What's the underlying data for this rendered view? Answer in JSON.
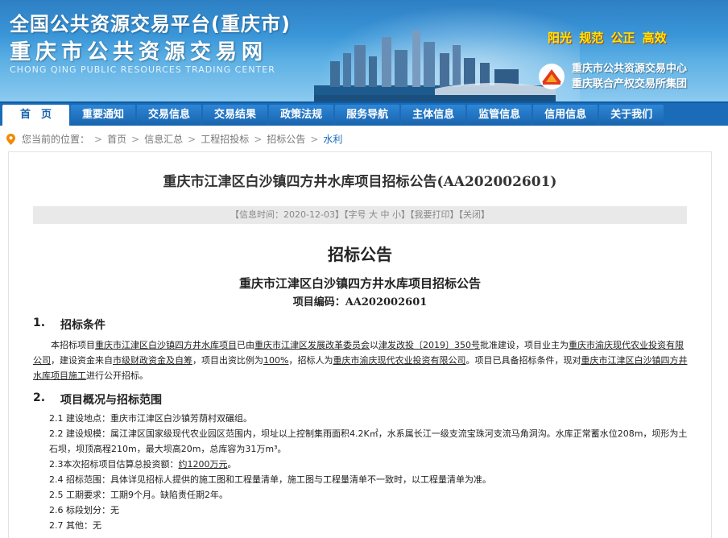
{
  "header": {
    "title_cn": "全国公共资源交易平台(重庆市)",
    "subtitle_cn": "重庆市公共资源交易网",
    "title_en": "CHONG QING PUBLIC RESOURCES TRADING CENTER",
    "slogan": "阳光 规范 公正 高效",
    "org_line1": "重庆市公共资源交易中心",
    "org_line2": "重庆联合产权交易所集团"
  },
  "nav": {
    "items": [
      {
        "label": "首　页"
      },
      {
        "label": "重要通知"
      },
      {
        "label": "交易信息"
      },
      {
        "label": "交易结果"
      },
      {
        "label": "政策法规"
      },
      {
        "label": "服务导航"
      },
      {
        "label": "主体信息"
      },
      {
        "label": "监管信息"
      },
      {
        "label": "信用信息"
      },
      {
        "label": "关于我们"
      }
    ]
  },
  "breadcrumb": {
    "prefix": "您当前的位置：",
    "items": [
      "首页",
      "信息汇总",
      "工程招投标",
      "招标公告",
      "水利"
    ],
    "separator": ">"
  },
  "article": {
    "title": "重庆市江津区白沙镇四方井水库项目招标公告(AA202002601)",
    "meta": {
      "time": "【信息时间：2020-12-03】",
      "font_label": "【字号",
      "font_large": "大",
      "font_medium": "中",
      "font_small": "小】",
      "print": "【我要打印】",
      "close": "【关闭】"
    }
  },
  "document": {
    "heading": "招标公告",
    "subheading": "重庆市江津区白沙镇四方井水库项目招标公告",
    "code": "项目编码：AA202002601",
    "sections": [
      {
        "num": "1.",
        "title": "招标条件"
      },
      {
        "num": "2.",
        "title": "项目概况与招标范围"
      }
    ],
    "para1": {
      "t1": "本招标项目",
      "u1": "重庆市江津区白沙镇四方井水库项目",
      "t2": "已由",
      "u2": "重庆市江津区发展改革委员会",
      "t3": "以",
      "u3": "津发改投〔2019〕350号",
      "t4": "批准建设，项目业主为",
      "u4": "重庆市渝庆现代农业投资有限公司",
      "t5": "，建设资金来自",
      "u5": "市级财政资金及自筹",
      "t6": "，项目出资比例为",
      "u6": "100%",
      "t7": "，招标人为",
      "u7": "重庆市渝庆现代农业投资有限公司",
      "t8": "。项目已具备招标条件，现对",
      "u8": "重庆市江津区白沙镇四方井水库项目施工",
      "t9": "进行公开招标。"
    },
    "items": [
      "2.1 建设地点：重庆市江津区白沙镇芳荫村双碾组。",
      "2.2 建设规模：属江津区国家级现代农业园区范围内，坝址以上控制集雨面积4.2K㎡，水系属长江一级支流宝珠河支流马角洞沟。水库正常蓄水位208m，坝形为土石坝，坝顶高程210m，最大坝高20m，总库容为31万m³。",
      "2.4 招标范围：具体详见招标人提供的施工图和工程量清单，施工图与工程量清单不一致时，以工程量清单为准。",
      "2.5 工期要求：工期9个月。缺陷责任期2年。",
      "2.6 标段划分：无",
      "2.7 其他：无"
    ],
    "item23": {
      "prefix": "2.3本次招标项目估算总投资额：",
      "value": "约1200万元",
      "suffix": "。"
    }
  },
  "colors": {
    "nav_bg": "#1a6bb8",
    "slogan": "#ffe600",
    "link": "#1a6bb8"
  }
}
